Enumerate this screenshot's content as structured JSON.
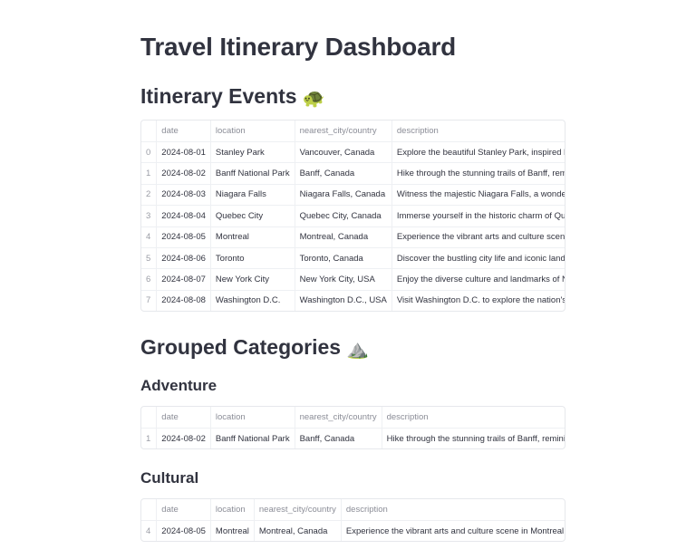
{
  "title": "Travel Itinerary Dashboard",
  "events": {
    "heading": "Itinerary Events",
    "emoji": "🐢",
    "columns": [
      "",
      "date",
      "location",
      "nearest_city/country",
      "description"
    ],
    "rows": [
      [
        "0",
        "2024-08-01",
        "Stanley Park",
        "Vancouver, Canada",
        "Explore the beautiful Stanley Park, inspired by lus"
      ],
      [
        "1",
        "2024-08-02",
        "Banff National Park",
        "Banff, Canada",
        "Hike through the stunning trails of Banff, reminisc"
      ],
      [
        "2",
        "2024-08-03",
        "Niagara Falls",
        "Niagara Falls, Canada",
        "Witness the majestic Niagara Falls, a wonder that"
      ],
      [
        "3",
        "2024-08-04",
        "Quebec City",
        "Quebec City, Canada",
        "Immerse yourself in the historic charm of Quebec"
      ],
      [
        "4",
        "2024-08-05",
        "Montreal",
        "Montreal, Canada",
        "Experience the vibrant arts and culture scene in M"
      ],
      [
        "5",
        "2024-08-06",
        "Toronto",
        "Toronto, Canada",
        "Discover the bustling city life and iconic landmarl"
      ],
      [
        "6",
        "2024-08-07",
        "New York City",
        "New York City, USA",
        "Enjoy the diverse culture and landmarks of New Y"
      ],
      [
        "7",
        "2024-08-08",
        "Washington D.C.",
        "Washington D.C., USA",
        "Visit Washington D.C. to explore the nation's capi"
      ]
    ]
  },
  "grouped": {
    "heading": "Grouped Categories",
    "emoji": "⛰️",
    "groups": [
      {
        "name": "Adventure",
        "columns": [
          "",
          "date",
          "location",
          "nearest_city/country",
          "description"
        ],
        "rows": [
          [
            "1",
            "2024-08-02",
            "Banff National Park",
            "Banff, Canada",
            "Hike through the stunning trails of Banff, reminisc"
          ]
        ]
      },
      {
        "name": "Cultural",
        "columns": [
          "",
          "date",
          "location",
          "nearest_city/country",
          "description"
        ],
        "rows": [
          [
            "4",
            "2024-08-05",
            "Montreal",
            "Montreal, Canada",
            "Experience the vibrant arts and culture scene in Montreal, re"
          ]
        ]
      }
    ]
  }
}
